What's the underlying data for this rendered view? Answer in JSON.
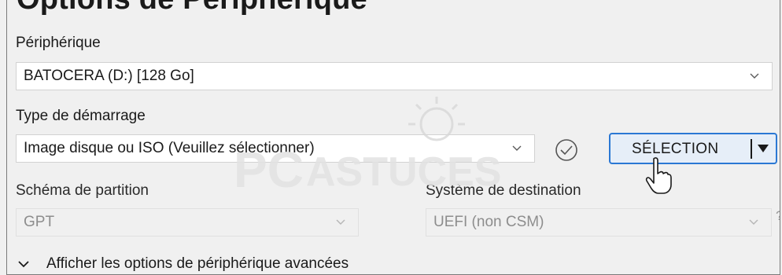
{
  "section": {
    "title": "Options de Périphérique"
  },
  "device": {
    "label": "Périphérique",
    "value": "BATOCERA (D:) [128 Go]"
  },
  "boot": {
    "label": "Type de démarrage",
    "value": "Image disque ou ISO (Veuillez sélectionner)",
    "select_button": "SÉLECTION"
  },
  "partition": {
    "label": "Schéma de partition",
    "value": "GPT"
  },
  "target": {
    "label": "Système de destination",
    "value": "UEFI (non CSM)",
    "help": "?"
  },
  "advanced": {
    "label": "Afficher les options de périphérique avancées"
  },
  "watermark": {
    "text_pc": "PC",
    "text_astuces": "ASTUCES"
  },
  "icons": {
    "check": "check-circle-icon",
    "chevron": "chevron-down-icon",
    "dropdown": "dropdown-arrow-icon",
    "cursor": "mouse-pointer-icon"
  },
  "colors": {
    "accent": "#2b78d4",
    "button_bg": "#e6eef8",
    "panel_bg": "#f0f0f0"
  }
}
